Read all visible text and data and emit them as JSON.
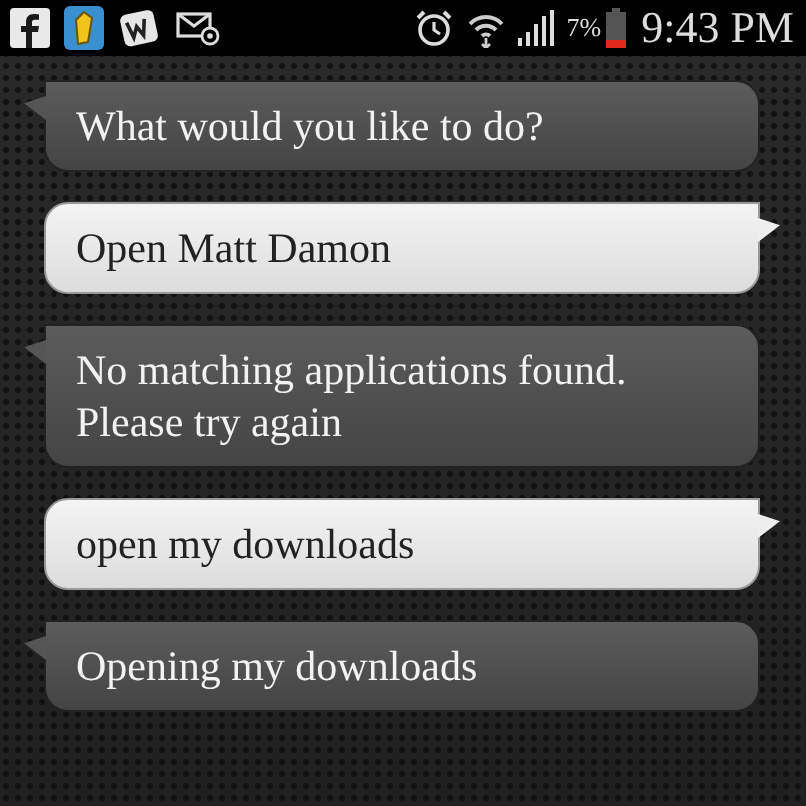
{
  "status_bar": {
    "battery_text": "7%",
    "time": "9:43 PM"
  },
  "messages": [
    {
      "kind": "system",
      "text": "What would you like to do?"
    },
    {
      "kind": "user",
      "text": "Open Matt Damon"
    },
    {
      "kind": "system",
      "text": "No matching applications found. Please try again"
    },
    {
      "kind": "user",
      "text": "open my downloads"
    },
    {
      "kind": "system",
      "text": "Opening my downloads"
    }
  ]
}
